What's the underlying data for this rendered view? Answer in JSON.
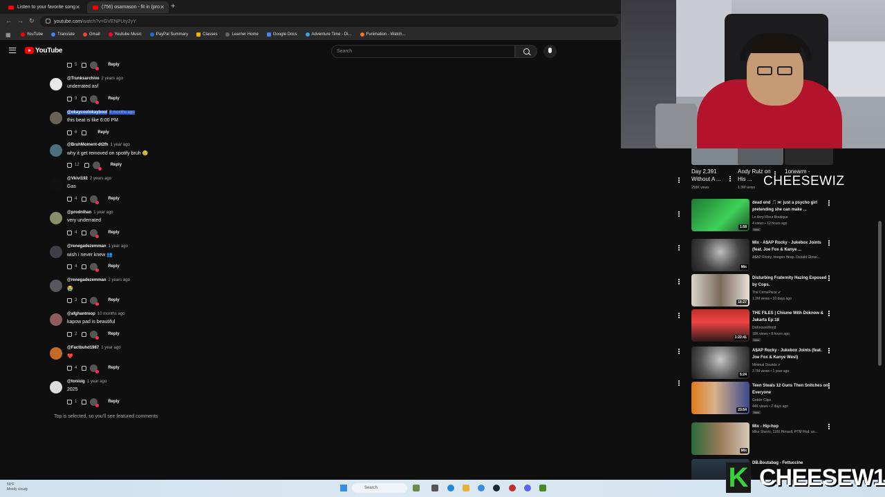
{
  "browser": {
    "tabs": [
      {
        "label": "Listen to your favorite song"
      },
      {
        "label": "(756) osamason - fit in (pro"
      }
    ],
    "url_host": "youtube.com",
    "url_path": "/watch?v=GVENPUty2yY",
    "bookmarks": [
      "YouTube",
      "Translate",
      "Gmail",
      "Youtube Music",
      "PayPal Summary",
      "Classes",
      "Learner Home",
      "Google Docs",
      "Adventure Time - Di...",
      "Funimation - Watch..."
    ]
  },
  "youtube": {
    "brand": "YouTube",
    "search_placeholder": "Search"
  },
  "comments": {
    "top_stub": {
      "likes": "5",
      "reply": "Reply"
    },
    "items": [
      {
        "handle": "@Trunksarchive",
        "ago": "2 years ago",
        "text": "underrated asf",
        "likes": "9",
        "reply": "Reply"
      },
      {
        "handle": "@okaycoolokaybool",
        "ago": "8 months ago",
        "text": "this beat is like 6:00 PM",
        "likes": "6",
        "reply": "Reply"
      },
      {
        "handle": "@BruhMoment-dt2fh",
        "ago": "1 year ago",
        "text": "why it get removed on spotify bruh 😢",
        "likes": "12",
        "reply": "Reply"
      },
      {
        "handle": "@Vkivi192",
        "ago": "2 years ago",
        "text": "Gas",
        "likes": "4",
        "reply": "Reply"
      },
      {
        "handle": "@prodnlhan",
        "ago": "1 year ago",
        "text": "very underrated",
        "likes": "4",
        "reply": "Reply"
      },
      {
        "handle": "@renegadezemman",
        "ago": "1 year ago",
        "text": "wish i never knew 👥",
        "likes": "4",
        "reply": "Reply"
      },
      {
        "handle": "@renegadezemman",
        "ago": "2 years ago",
        "text": "😭",
        "likes": "3",
        "reply": "Reply"
      },
      {
        "handle": "@afghantroop",
        "ago": "10 months ago",
        "text": "kapow pad is beautiful",
        "likes": "2",
        "reply": "Reply"
      },
      {
        "handle": "@Factbuhd1987",
        "ago": "1 year ago",
        "text": "❤️",
        "likes": "4",
        "reply": "Reply"
      },
      {
        "handle": "@tonioig",
        "ago": "1 year ago",
        "text": "2025",
        "likes": "1",
        "reply": "Reply"
      }
    ],
    "footer": "Top is selected, so you'll see featured comments"
  },
  "sidebar": {
    "overlay_name": "CHEESEWIZ",
    "top_row": [
      {
        "title_line1": "Day 2,391",
        "title_line2": "Without A ...",
        "views": "258K views"
      },
      {
        "title_line1": "Andy Rulz on",
        "title_line2": "His ...",
        "views": "1.3M views"
      },
      {
        "title_line1": "1onearm -",
        "title_line2": "",
        "views": ""
      }
    ],
    "videos": [
      {
        "title": "dead end 🎵📼 just a psycho girl pretending she can make ...",
        "channel": "Le Avryl Fleur Boutique",
        "meta": "4 views • 12 hours ago",
        "duration": "1:58",
        "badge": "New"
      },
      {
        "title": "Mix - A$AP Rocky - Jukebox Joints (feat. Joe Fox & Kanye ...",
        "channel": "A$AP Rocky, Imogen Heap, Donald Glove...",
        "meta": "",
        "duration": "Mix",
        "badge": ""
      },
      {
        "title": "Disturbing Fraternity Hazing Exposed by Cops.",
        "channel": "The CrimePiece ✔",
        "meta": "1.2M views • 10 days ago",
        "duration": "16:27",
        "badge": ""
      },
      {
        "title": "THE FILES | Chisme With Doknow & Jakarta Ep:18",
        "channel": "DoKnowsWorld",
        "meta": "18K views • 8 hours ago",
        "duration": "1:22:41",
        "badge": "New"
      },
      {
        "title": "A$AP Rocky - Jukebox Joints (feat. Joe Fox & Kanye West)",
        "channel": "Minimal Sounds ✔",
        "meta": "2.7M views • 1 year ago",
        "duration": "5:24",
        "badge": ""
      },
      {
        "title": "Teen Steals 12 Guns Then Snitches on Everyone",
        "channel": "Goblin Clips",
        "meta": "44K views • 2 days ago",
        "duration": "23:54",
        "badge": "New"
      },
      {
        "title": "Mix - Hip-hop",
        "channel": "Mike Sherm, 1100 Himself, PTM Hod, an...",
        "meta": "",
        "duration": "Mix",
        "badge": ""
      },
      {
        "title": "DB.Boutabag - Fettuccine",
        "channel": "",
        "meta": "",
        "duration": "",
        "badge": ""
      }
    ]
  },
  "taskbar": {
    "weather_temp": "59°F",
    "weather_desc": "Mostly cloudy",
    "search": "Search"
  },
  "watermark": {
    "letter": "K",
    "name": "CHEESEW1Z"
  },
  "colors": {
    "accent": "#ff0000",
    "selection": "#2a5bd7",
    "background": "#0f0f0f"
  }
}
